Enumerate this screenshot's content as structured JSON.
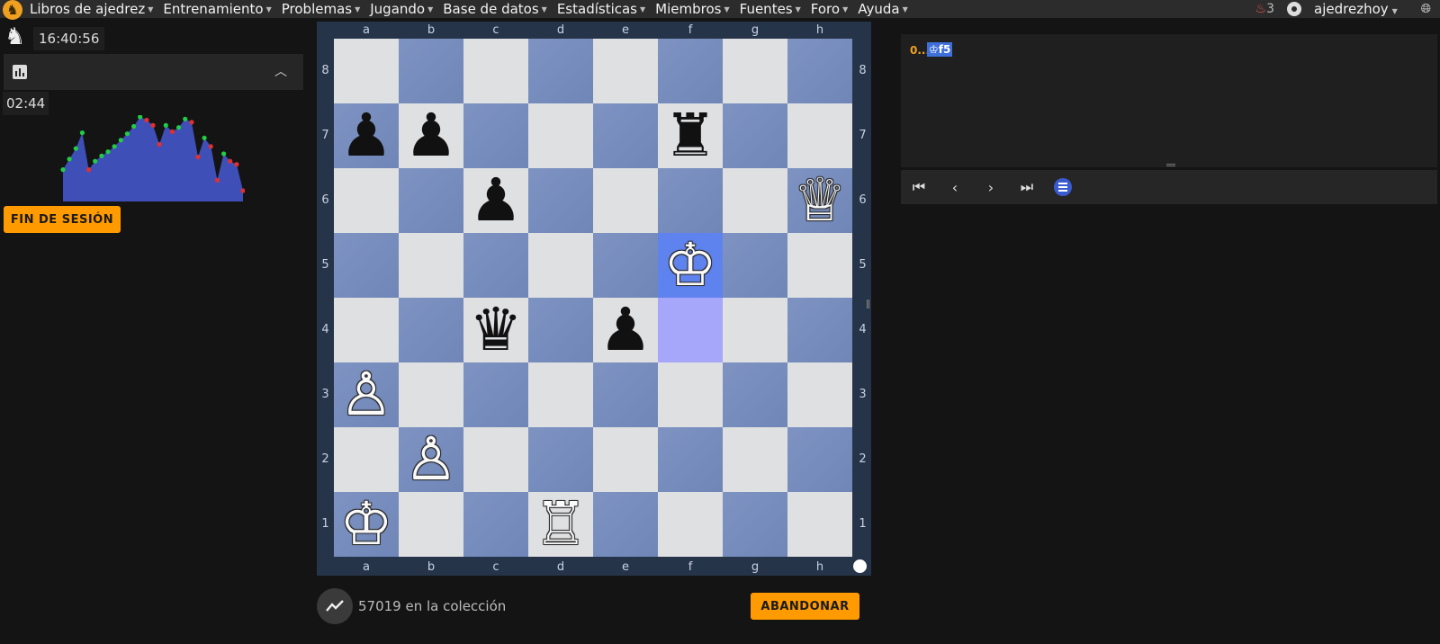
{
  "nav": {
    "logo_icon": "chess-logo-icon",
    "items": [
      {
        "label": "Libros de ajedrez"
      },
      {
        "label": "Entrenamiento"
      },
      {
        "label": "Problemas"
      },
      {
        "label": "Jugando"
      },
      {
        "label": "Base de datos"
      },
      {
        "label": "Estadísticas"
      },
      {
        "label": "Miembros"
      },
      {
        "label": "Fuentes"
      },
      {
        "label": "Foro"
      },
      {
        "label": "Ayuda"
      }
    ],
    "notif_count": "3",
    "username": "ajedrezhoy"
  },
  "session": {
    "clock": "16:40:56",
    "timer": "02:44",
    "end_label": "FIN DE SESIÓN",
    "sparkline": [
      50,
      40,
      30,
      15,
      50,
      42,
      37,
      33,
      28,
      22,
      16,
      9,
      0,
      3,
      8,
      26,
      8,
      14,
      10,
      2,
      5,
      38,
      20,
      28,
      60,
      35,
      42,
      45,
      70
    ]
  },
  "board": {
    "files": [
      "a",
      "b",
      "c",
      "d",
      "e",
      "f",
      "g",
      "h"
    ],
    "ranks": [
      "8",
      "7",
      "6",
      "5",
      "4",
      "3",
      "2",
      "1"
    ],
    "pieces": [
      {
        "sq": "a7",
        "glyph": "♟",
        "color": "black",
        "name": "black-pawn-a7"
      },
      {
        "sq": "b7",
        "glyph": "♟",
        "color": "black",
        "name": "black-pawn-b7"
      },
      {
        "sq": "f7",
        "glyph": "♜",
        "color": "black",
        "name": "black-rook-f7"
      },
      {
        "sq": "c6",
        "glyph": "♟",
        "color": "black",
        "name": "black-pawn-c6"
      },
      {
        "sq": "h6",
        "glyph": "♕",
        "color": "white",
        "name": "white-queen-h6"
      },
      {
        "sq": "f5",
        "glyph": "♔",
        "color": "white",
        "name": "white-king-f5"
      },
      {
        "sq": "c4",
        "glyph": "♛",
        "color": "black",
        "name": "black-queen-c4"
      },
      {
        "sq": "e4",
        "glyph": "♟",
        "color": "black",
        "name": "black-pawn-e4"
      },
      {
        "sq": "a3",
        "glyph": "♙",
        "color": "white",
        "name": "white-pawn-a3"
      },
      {
        "sq": "b2",
        "glyph": "♙",
        "color": "white",
        "name": "white-pawn-b2"
      },
      {
        "sq": "a1",
        "glyph": "♔",
        "color": "white",
        "name": "white-king-a1"
      },
      {
        "sq": "d1",
        "glyph": "♖",
        "color": "white",
        "name": "white-rook-d1"
      }
    ],
    "highlight_from": "f4",
    "highlight_to": "f5"
  },
  "footer": {
    "collection_text": "57019 en la colección",
    "resign_label": "ABANDONAR"
  },
  "moves": {
    "move_number": "0...",
    "move_san": "♔f5"
  },
  "colors": {
    "accent": "#ff9b00",
    "board_light": "#dfe0e2",
    "board_dark": "#7e93c2",
    "highlight_from": "#a6a6fa",
    "highlight_to": "#5f83ee",
    "spark_fill": "#3f4fb8",
    "spark_up": "#22cc44",
    "spark_down": "#e03030"
  }
}
